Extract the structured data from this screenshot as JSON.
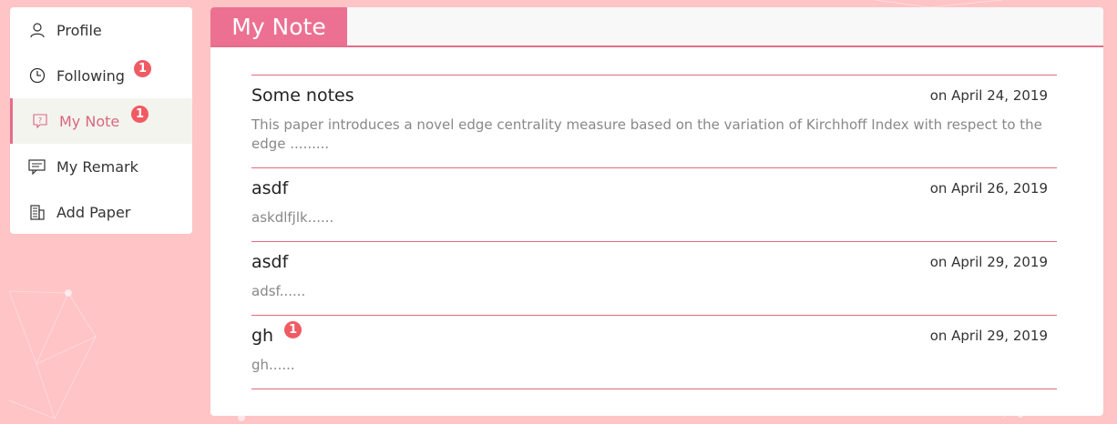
{
  "sidebar": {
    "items": [
      {
        "label": "Profile",
        "icon": "user-icon"
      },
      {
        "label": "Following",
        "icon": "clock-icon",
        "badge": "1"
      },
      {
        "label": "My Note",
        "icon": "note-icon",
        "badge": "1",
        "active": true
      },
      {
        "label": "My Remark",
        "icon": "comment-icon"
      },
      {
        "label": "Add Paper",
        "icon": "building-icon"
      }
    ]
  },
  "main": {
    "title": "My Note",
    "notes": [
      {
        "title": "Some notes",
        "date": "on April 24, 2019",
        "desc": "This paper introduces a novel edge centrality measure based on the variation of Kirchhoff Index with respect to the edge ........."
      },
      {
        "title": "asdf",
        "date": "on April 26, 2019",
        "desc": "askdlfjlk......"
      },
      {
        "title": "asdf",
        "date": "on April 29, 2019",
        "desc": "adsf......"
      },
      {
        "title": "gh",
        "date": "on April 29, 2019",
        "desc": "gh......",
        "badge": "1"
      }
    ]
  },
  "colors": {
    "background": "#ffc4c6",
    "accent": "#ec7091",
    "badge": "#f05b63",
    "divider": "#e06c79"
  }
}
